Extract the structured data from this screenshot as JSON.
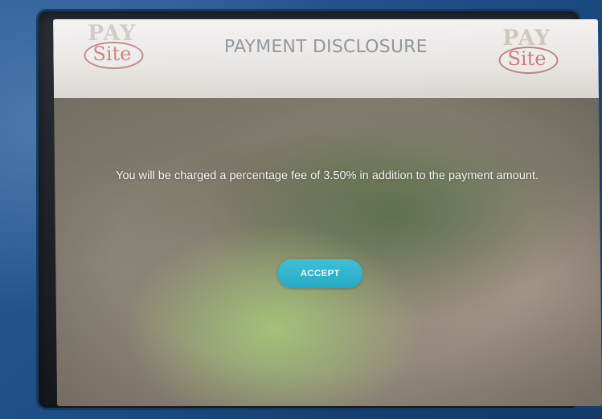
{
  "header": {
    "title": "PAYMENT DISCLOSURE",
    "logo_left": {
      "top": "PAY",
      "bottom": "Site"
    },
    "logo_right": {
      "top": "PAY",
      "bottom": "Site"
    }
  },
  "main": {
    "message": "You will be charged a percentage fee of 3.50% in addition to the payment amount.",
    "accept_label": "ACCEPT"
  },
  "colors": {
    "accent_button": "#2bb0cb",
    "header_text": "#8d9397",
    "logo_site": "#c46d68",
    "kiosk_body": "#1f4f86"
  }
}
